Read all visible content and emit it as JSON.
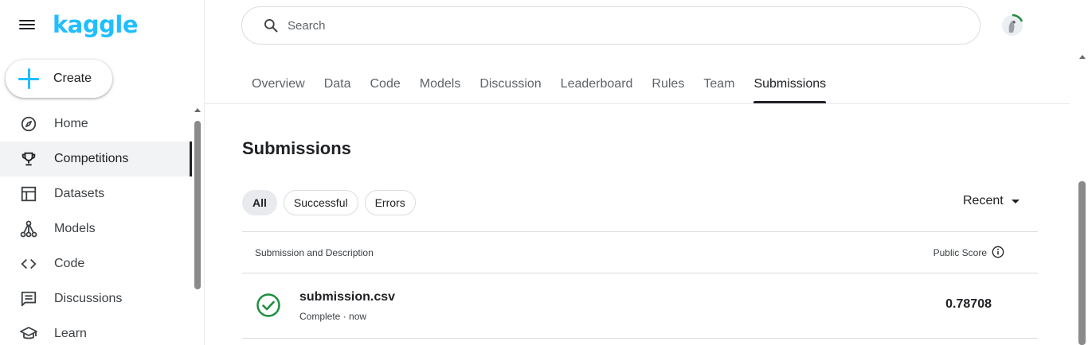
{
  "brand": {
    "logo": "kaggle",
    "color": "#20beff"
  },
  "create_button": {
    "label": "Create"
  },
  "sidebar": {
    "items": [
      {
        "label": "Home",
        "icon": "compass-icon",
        "active": false
      },
      {
        "label": "Competitions",
        "icon": "trophy-icon",
        "active": true
      },
      {
        "label": "Datasets",
        "icon": "table-icon",
        "active": false
      },
      {
        "label": "Models",
        "icon": "models-icon",
        "active": false
      },
      {
        "label": "Code",
        "icon": "code-icon",
        "active": false
      },
      {
        "label": "Discussions",
        "icon": "comment-icon",
        "active": false
      },
      {
        "label": "Learn",
        "icon": "school-icon",
        "active": false
      }
    ]
  },
  "search": {
    "placeholder": "Search"
  },
  "tabs": [
    {
      "label": "Overview"
    },
    {
      "label": "Data"
    },
    {
      "label": "Code"
    },
    {
      "label": "Models"
    },
    {
      "label": "Discussion"
    },
    {
      "label": "Leaderboard"
    },
    {
      "label": "Rules"
    },
    {
      "label": "Team"
    },
    {
      "label": "Submissions",
      "active": true
    }
  ],
  "page": {
    "title": "Submissions"
  },
  "filters": [
    {
      "label": "All",
      "active": true
    },
    {
      "label": "Successful"
    },
    {
      "label": "Errors"
    }
  ],
  "sort": {
    "label": "Recent"
  },
  "table": {
    "headers": {
      "submission": "Submission and Description",
      "score": "Public Score"
    },
    "rows": [
      {
        "file": "submission.csv",
        "status": "Complete · now",
        "score": "0.78708",
        "status_color": "#1e8e3e"
      }
    ]
  }
}
